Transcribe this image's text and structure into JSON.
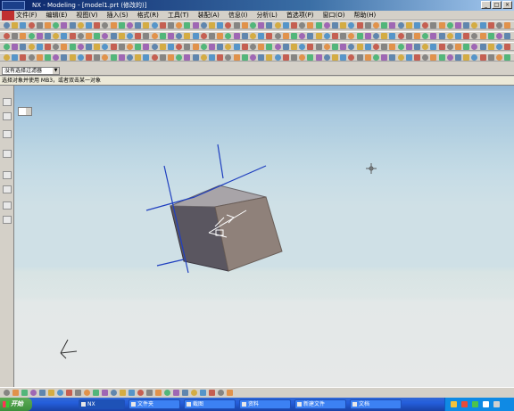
{
  "window": {
    "title": "NX - Modeling - [model1.prt (修改的)]",
    "buttons": [
      "_",
      "□",
      "×"
    ]
  },
  "menubar": {
    "items": [
      "文件(F)",
      "编辑(E)",
      "视图(V)",
      "插入(S)",
      "格式(R)",
      "工具(T)",
      "装配(A)",
      "信息(I)",
      "分析(L)",
      "首选项(P)",
      "窗口(O)",
      "帮助(H)"
    ]
  },
  "selection_filter": {
    "value": "没有选择过滤器"
  },
  "cue_line": {
    "text": "选择对象并使用 MB3，或者双击某一对象"
  },
  "taskbar": {
    "start_label": "开始",
    "tasks": [
      {
        "label": "NX"
      },
      {
        "label": "文件夹"
      },
      {
        "label": "截图"
      },
      {
        "label": "资料"
      },
      {
        "label": "新建文件"
      },
      {
        "label": "文档"
      }
    ]
  },
  "colors": {
    "accent": "#0a246a",
    "axis_blue": "#1f3fbf",
    "viewport_top": "#8fb5d6",
    "block_front": "#5a5660",
    "block_top": "#a8a4a8",
    "block_right": "#8f817a"
  }
}
